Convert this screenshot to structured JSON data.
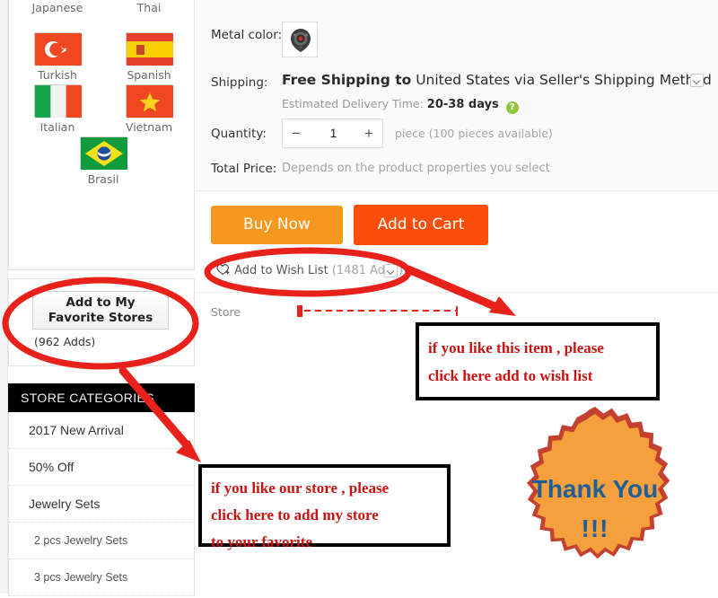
{
  "sidebar": {
    "languages": [
      {
        "label": "Japanese",
        "flag": "japan-flag"
      },
      {
        "label": "Thai",
        "flag": "thailand-flag"
      },
      {
        "label": "Turkish",
        "flag": "turkey-flag"
      },
      {
        "label": "Spanish",
        "flag": "spain-flag"
      },
      {
        "label": "Italian",
        "flag": "italy-flag"
      },
      {
        "label": "Vietnam",
        "flag": "vietnam-flag"
      },
      {
        "label": "Brasil",
        "flag": "brazil-flag"
      }
    ],
    "favorite": {
      "button_line1": "Add to My",
      "button_line2": "Favorite Stores",
      "count": "(962 Adds)"
    },
    "categories_header": "STORE CATEGORIES",
    "categories": [
      {
        "label": "2017 New Arrival",
        "sub": false
      },
      {
        "label": "50% Off",
        "sub": false
      },
      {
        "label": "Jewelry Sets",
        "sub": false
      },
      {
        "label": "2 pcs Jewelry Sets",
        "sub": true
      },
      {
        "label": "3 pcs Jewelry Sets",
        "sub": true
      }
    ]
  },
  "product": {
    "metal_color_label": "Metal color:",
    "metal_color_swatch": "pendant-thumbnail",
    "shipping_label": "Shipping:",
    "shipping_free": "Free Shipping to",
    "shipping_rest": "United States via Seller's Shipping Method",
    "eta_label": "Estimated Delivery Time:",
    "eta_value": "20-38 days",
    "eta_help": "?",
    "quantity_label": "Quantity:",
    "quantity_value": "1",
    "quantity_minus": "−",
    "quantity_plus": "+",
    "quantity_note": "piece (100 pieces available)",
    "total_price_label": "Total Price:",
    "total_price_value": "Depends on the product properties you select",
    "buy_now": "Buy Now",
    "add_to_cart": "Add to Cart",
    "wish_list": "Add to Wish List",
    "wish_list_count": "(1481 Adds)",
    "store_label": "Store"
  },
  "annotations": {
    "wish_note": {
      "line1": "if  you like this item , please",
      "line2": "click here add to wish list"
    },
    "store_note": {
      "line1": "if  you like our store , please",
      "line2": "click here to add my store",
      "line3": "to your favorite"
    },
    "thank_you": {
      "line1": "Thank You",
      "line2": "!!!"
    }
  },
  "colors": {
    "buy_now": "#f6981e",
    "add_to_cart": "#fb4f09",
    "annotation_red": "#cc1111",
    "marker_red": "#e8211a",
    "star_fill": "#f5a03c",
    "star_edge": "#c4412f",
    "star_text": "#1f5f96",
    "categories_header_bg": "#000000"
  }
}
